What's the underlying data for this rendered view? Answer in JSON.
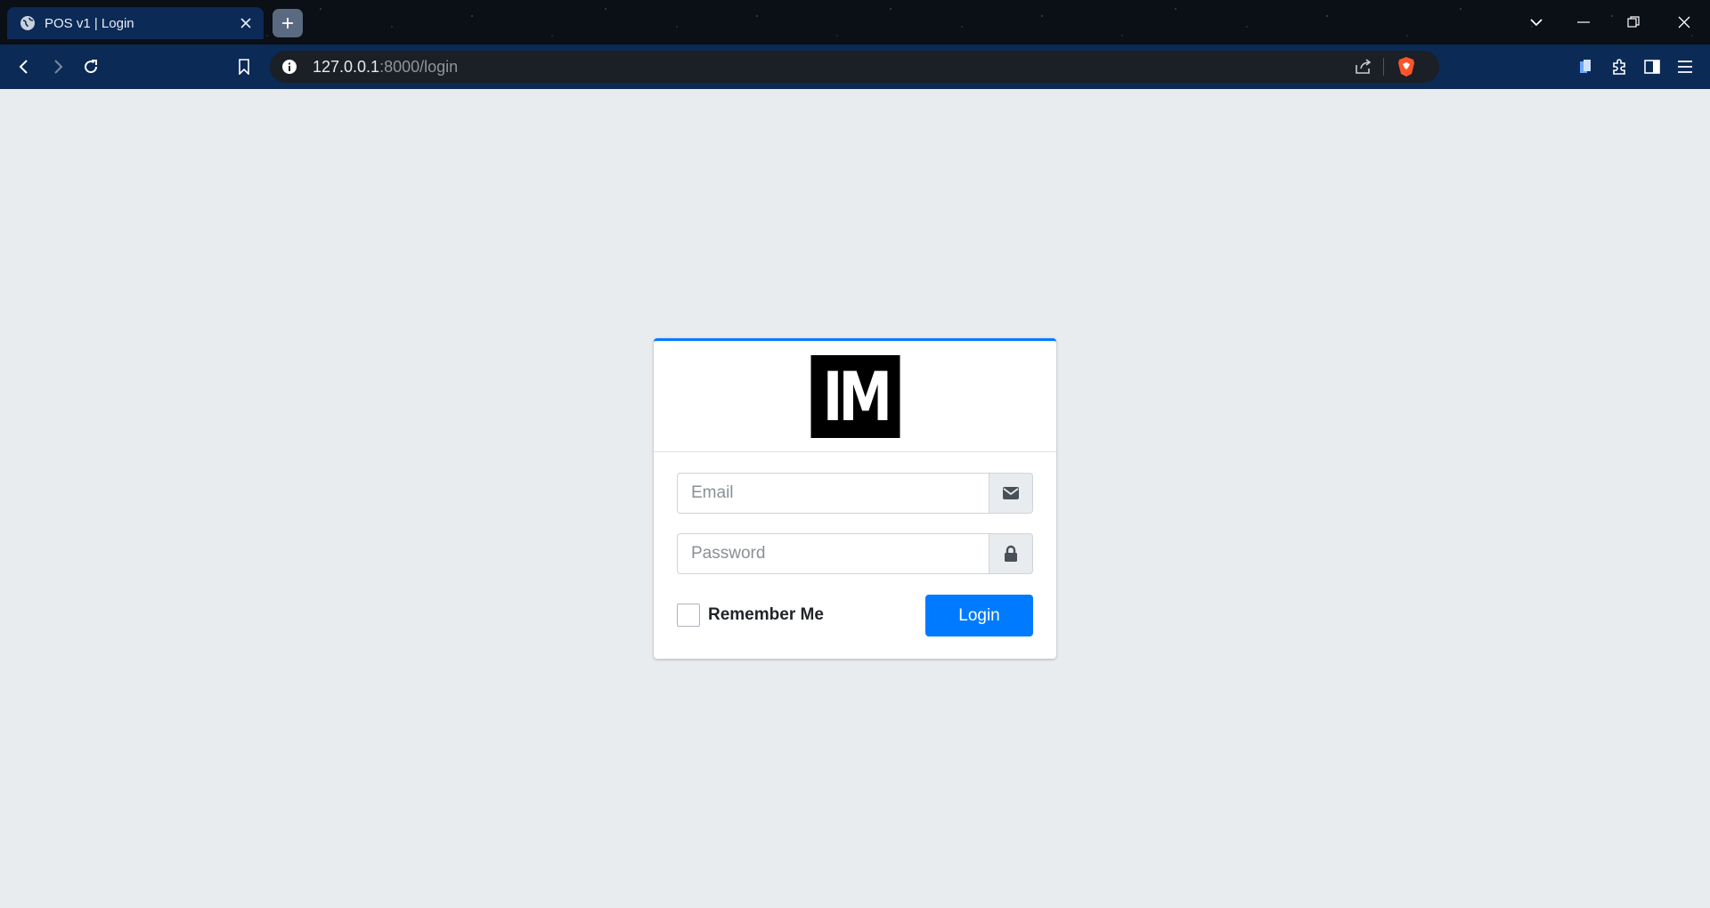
{
  "browser": {
    "tab_title": "POS v1 | Login",
    "url_host": "127.0.0.1",
    "url_rest": ":8000/login"
  },
  "login": {
    "logo_text": "IM",
    "email_placeholder": "Email",
    "password_placeholder": "Password",
    "remember_label": "Remember Me",
    "remember_checked": false,
    "login_button": "Login"
  },
  "colors": {
    "accent": "#007bff",
    "page_background": "#e9ecef",
    "toolbar_background": "#0b2a55"
  },
  "icons": {
    "email_addon": "envelope-icon",
    "password_addon": "lock-icon"
  }
}
